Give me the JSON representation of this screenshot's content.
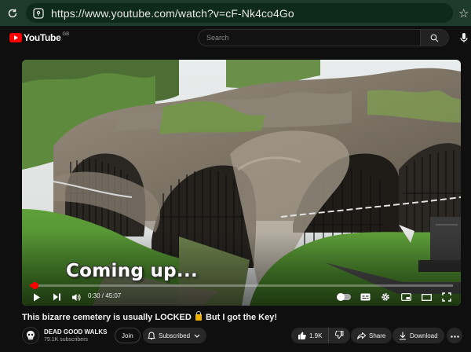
{
  "browser": {
    "url": "https://www.youtube.com/watch?v=cF-Nk4co4Go"
  },
  "header": {
    "logo_text": "YouTube",
    "country_code": "GB",
    "search_placeholder": "Search"
  },
  "video": {
    "caption": "Coming up...",
    "current_time": "0:30",
    "duration": "45:07",
    "time_display": "0:30 / 45:07",
    "progress_fraction": 0.011,
    "accent_color": "#ff0000"
  },
  "details": {
    "title_before_icon": "This bizarre cemetery is usually LOCKED",
    "title_after_icon": "But I got the Key!",
    "channel_name": "DEAD GOOD WALKS",
    "subscribers": "79.1K subscribers",
    "join_label": "Join",
    "subscribed_label": "Subscribed",
    "likes": "1.9K",
    "share_label": "Share",
    "download_label": "Download"
  }
}
